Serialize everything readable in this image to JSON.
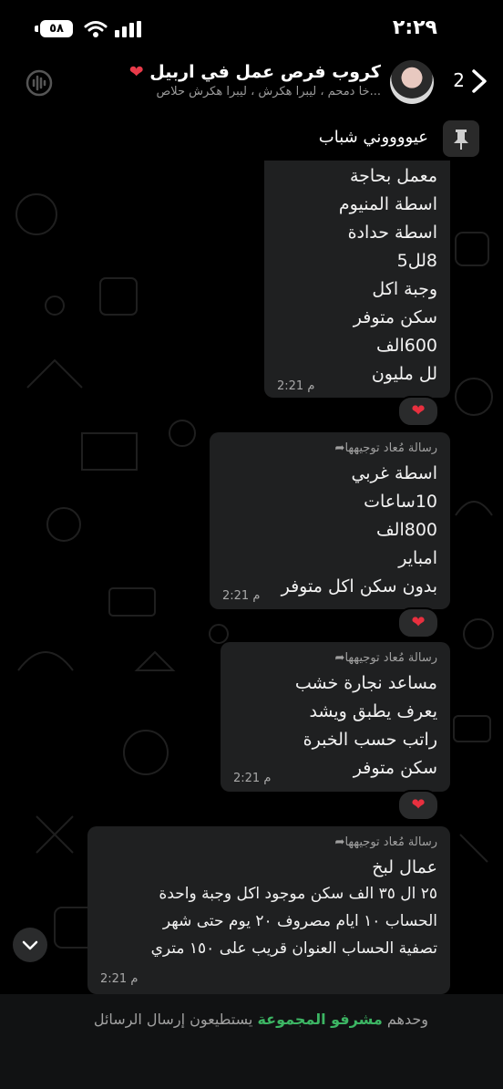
{
  "status_bar": {
    "time": "٢:٢٩",
    "battery": "٥٨"
  },
  "header": {
    "unread_count": "2",
    "title": "كروب فرص عمل في اربيل",
    "subtitle": "...خا دمحم ، ليبرا هكرش ، ليبرا هكرش حلاص"
  },
  "pinned": {
    "text": "عيووووني شباب"
  },
  "messages": [
    {
      "forwarded": "",
      "lines": [
        "معمل بحاجة",
        "اسطة المنيوم",
        "اسطة حدادة",
        "8لل5",
        "وجبة اكل",
        "سكن متوفر",
        "600الف",
        "لل مليون"
      ],
      "time": "2:21 م",
      "reaction": "❤"
    },
    {
      "forwarded": "رسالة مُعاد توجيهها",
      "lines": [
        "اسطة غربي",
        "10ساعات",
        "800الف",
        "امباير",
        "بدون سكن اكل  متوفر"
      ],
      "time": "2:21 م",
      "reaction": "❤"
    },
    {
      "forwarded": "رسالة مُعاد توجيهها",
      "lines": [
        "مساعد نجارة خشب",
        "يعرف يطبق ويشد",
        "راتب حسب الخبرة",
        "سكن متوفر"
      ],
      "time": "2:21 م",
      "reaction": "❤"
    },
    {
      "forwarded": "رسالة مُعاد توجيهها",
      "lines": [
        "عمال لبخ",
        "٢٥ ال ٣٥ الف سكن موجود اكل وجبة واحدة",
        "الحساب ١٠  ايام مصروف ٢٠ يوم حتى شهر",
        "تصفية الحساب  العنوان  قريب على ١٥٠ متري"
      ],
      "time": "2:21 م"
    }
  ],
  "footer": {
    "prefix": "وحدهم",
    "admins": "مشرفو المجموعة",
    "suffix": "يستطيعون إرسال الرسائل"
  },
  "colors": {
    "accent": "#3cb563",
    "bubble": "#1f2021",
    "reaction": "#e8303f"
  },
  "icons": [
    "back-chevron-icon",
    "pin-icon",
    "voice-chat-icon",
    "forward-arrow-icon",
    "heart-icon",
    "chevron-down-icon",
    "wifi-icon",
    "signal-icon",
    "battery-icon"
  ]
}
